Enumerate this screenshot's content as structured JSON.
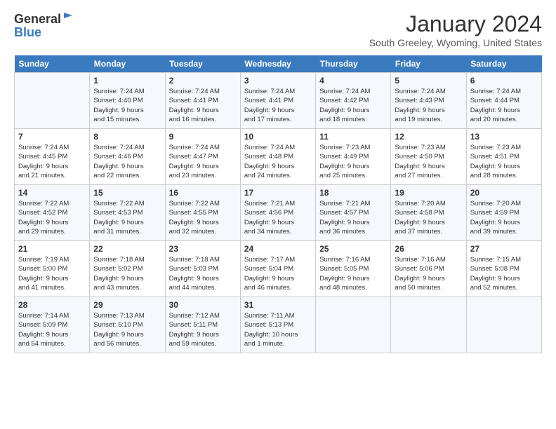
{
  "header": {
    "logo_general": "General",
    "logo_blue": "Blue",
    "month_year": "January 2024",
    "location": "South Greeley, Wyoming, United States"
  },
  "days_of_week": [
    "Sunday",
    "Monday",
    "Tuesday",
    "Wednesday",
    "Thursday",
    "Friday",
    "Saturday"
  ],
  "weeks": [
    [
      {
        "day": "",
        "sunrise": "",
        "sunset": "",
        "daylight": ""
      },
      {
        "day": "1",
        "sunrise": "Sunrise: 7:24 AM",
        "sunset": "Sunset: 4:40 PM",
        "daylight": "Daylight: 9 hours and 15 minutes."
      },
      {
        "day": "2",
        "sunrise": "Sunrise: 7:24 AM",
        "sunset": "Sunset: 4:41 PM",
        "daylight": "Daylight: 9 hours and 16 minutes."
      },
      {
        "day": "3",
        "sunrise": "Sunrise: 7:24 AM",
        "sunset": "Sunset: 4:41 PM",
        "daylight": "Daylight: 9 hours and 17 minutes."
      },
      {
        "day": "4",
        "sunrise": "Sunrise: 7:24 AM",
        "sunset": "Sunset: 4:42 PM",
        "daylight": "Daylight: 9 hours and 18 minutes."
      },
      {
        "day": "5",
        "sunrise": "Sunrise: 7:24 AM",
        "sunset": "Sunset: 4:43 PM",
        "daylight": "Daylight: 9 hours and 19 minutes."
      },
      {
        "day": "6",
        "sunrise": "Sunrise: 7:24 AM",
        "sunset": "Sunset: 4:44 PM",
        "daylight": "Daylight: 9 hours and 20 minutes."
      }
    ],
    [
      {
        "day": "7",
        "sunrise": "",
        "sunset": "",
        "daylight": ""
      },
      {
        "day": "8",
        "sunrise": "Sunrise: 7:24 AM",
        "sunset": "Sunset: 4:46 PM",
        "daylight": "Daylight: 9 hours and 22 minutes."
      },
      {
        "day": "9",
        "sunrise": "Sunrise: 7:24 AM",
        "sunset": "Sunset: 4:47 PM",
        "daylight": "Daylight: 9 hours and 23 minutes."
      },
      {
        "day": "10",
        "sunrise": "Sunrise: 7:24 AM",
        "sunset": "Sunset: 4:48 PM",
        "daylight": "Daylight: 9 hours and 24 minutes."
      },
      {
        "day": "11",
        "sunrise": "Sunrise: 7:23 AM",
        "sunset": "Sunset: 4:49 PM",
        "daylight": "Daylight: 9 hours and 25 minutes."
      },
      {
        "day": "12",
        "sunrise": "Sunrise: 7:23 AM",
        "sunset": "Sunset: 4:50 PM",
        "daylight": "Daylight: 9 hours and 27 minutes."
      },
      {
        "day": "13",
        "sunrise": "Sunrise: 7:23 AM",
        "sunset": "Sunset: 4:51 PM",
        "daylight": "Daylight: 9 hours and 28 minutes."
      }
    ],
    [
      {
        "day": "14",
        "sunrise": "",
        "sunset": "",
        "daylight": ""
      },
      {
        "day": "15",
        "sunrise": "Sunrise: 7:22 AM",
        "sunset": "Sunset: 4:53 PM",
        "daylight": "Daylight: 9 hours and 31 minutes."
      },
      {
        "day": "16",
        "sunrise": "Sunrise: 7:22 AM",
        "sunset": "Sunset: 4:55 PM",
        "daylight": "Daylight: 9 hours and 32 minutes."
      },
      {
        "day": "17",
        "sunrise": "Sunrise: 7:21 AM",
        "sunset": "Sunset: 4:56 PM",
        "daylight": "Daylight: 9 hours and 34 minutes."
      },
      {
        "day": "18",
        "sunrise": "Sunrise: 7:21 AM",
        "sunset": "Sunset: 4:57 PM",
        "daylight": "Daylight: 9 hours and 36 minutes."
      },
      {
        "day": "19",
        "sunrise": "Sunrise: 7:20 AM",
        "sunset": "Sunset: 4:58 PM",
        "daylight": "Daylight: 9 hours and 37 minutes."
      },
      {
        "day": "20",
        "sunrise": "Sunrise: 7:20 AM",
        "sunset": "Sunset: 4:59 PM",
        "daylight": "Daylight: 9 hours and 39 minutes."
      }
    ],
    [
      {
        "day": "21",
        "sunrise": "",
        "sunset": "",
        "daylight": ""
      },
      {
        "day": "22",
        "sunrise": "Sunrise: 7:18 AM",
        "sunset": "Sunset: 5:02 PM",
        "daylight": "Daylight: 9 hours and 43 minutes."
      },
      {
        "day": "23",
        "sunrise": "Sunrise: 7:18 AM",
        "sunset": "Sunset: 5:03 PM",
        "daylight": "Daylight: 9 hours and 44 minutes."
      },
      {
        "day": "24",
        "sunrise": "Sunrise: 7:17 AM",
        "sunset": "Sunset: 5:04 PM",
        "daylight": "Daylight: 9 hours and 46 minutes."
      },
      {
        "day": "25",
        "sunrise": "Sunrise: 7:16 AM",
        "sunset": "Sunset: 5:05 PM",
        "daylight": "Daylight: 9 hours and 48 minutes."
      },
      {
        "day": "26",
        "sunrise": "Sunrise: 7:16 AM",
        "sunset": "Sunset: 5:06 PM",
        "daylight": "Daylight: 9 hours and 50 minutes."
      },
      {
        "day": "27",
        "sunrise": "Sunrise: 7:15 AM",
        "sunset": "Sunset: 5:08 PM",
        "daylight": "Daylight: 9 hours and 52 minutes."
      }
    ],
    [
      {
        "day": "28",
        "sunrise": "Sunrise: 7:14 AM",
        "sunset": "Sunset: 5:09 PM",
        "daylight": "Daylight: 9 hours and 54 minutes."
      },
      {
        "day": "29",
        "sunrise": "Sunrise: 7:13 AM",
        "sunset": "Sunset: 5:10 PM",
        "daylight": "Daylight: 9 hours and 56 minutes."
      },
      {
        "day": "30",
        "sunrise": "Sunrise: 7:12 AM",
        "sunset": "Sunset: 5:11 PM",
        "daylight": "Daylight: 9 hours and 59 minutes."
      },
      {
        "day": "31",
        "sunrise": "Sunrise: 7:11 AM",
        "sunset": "Sunset: 5:13 PM",
        "daylight": "Daylight: 10 hours and 1 minute."
      },
      {
        "day": "",
        "sunrise": "",
        "sunset": "",
        "daylight": ""
      },
      {
        "day": "",
        "sunrise": "",
        "sunset": "",
        "daylight": ""
      },
      {
        "day": "",
        "sunrise": "",
        "sunset": "",
        "daylight": ""
      }
    ]
  ],
  "week7_sun": {
    "sunrise": "Sunrise: 7:24 AM",
    "sunset": "Sunset: 4:45 PM",
    "daylight": "Daylight: 9 hours and 21 minutes."
  },
  "week14_sun": {
    "sunrise": "Sunrise: 7:22 AM",
    "sunset": "Sunset: 4:52 PM",
    "daylight": "Daylight: 9 hours and 29 minutes."
  },
  "week21_sun": {
    "sunrise": "Sunrise: 7:19 AM",
    "sunset": "Sunset: 5:00 PM",
    "daylight": "Daylight: 9 hours and 41 minutes."
  }
}
